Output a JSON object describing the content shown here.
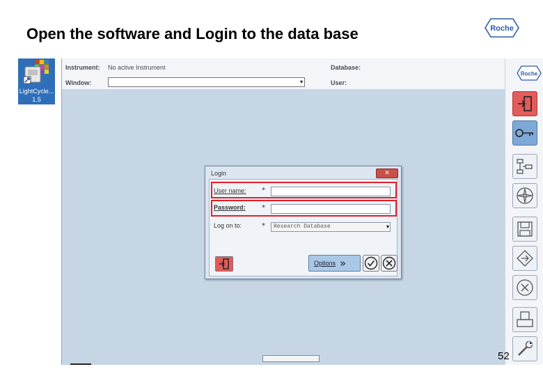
{
  "slide": {
    "title": "Open the software and Login to the data base",
    "logo_text": "Roche",
    "page_number": "52"
  },
  "desktop_icon": {
    "label_line1": "LightCycle...",
    "label_line2": "1.5"
  },
  "app": {
    "header": {
      "instrument_label": "Instrument:",
      "instrument_value": "No active Instrument",
      "window_label": "Window:",
      "window_value": "",
      "database_label": "Database:",
      "database_value": "",
      "user_label": "User:",
      "user_value": ""
    },
    "toolbar": {
      "logo_text": "Roche",
      "buttons": [
        {
          "icon": "exit-icon",
          "state": "red"
        },
        {
          "icon": "key-icon",
          "state": "active"
        },
        {
          "icon": "navigator-icon",
          "state": "normal"
        },
        {
          "icon": "compass-icon",
          "state": "normal"
        },
        {
          "icon": "save-icon",
          "state": "normal"
        },
        {
          "icon": "export-icon",
          "state": "normal"
        },
        {
          "icon": "close-icon",
          "state": "normal"
        },
        {
          "icon": "print-icon",
          "state": "normal"
        },
        {
          "icon": "tools-icon",
          "state": "normal"
        }
      ]
    }
  },
  "login_dialog": {
    "title": "Login",
    "close_label": "✕",
    "username_label": "User name:",
    "username_value": "",
    "password_label": "Password:",
    "password_value": "",
    "logon_label": "Log on to:",
    "logon_value": "Research Database",
    "required_marker": "*",
    "options_label": "Options",
    "highlight_color": "#e0202a"
  }
}
